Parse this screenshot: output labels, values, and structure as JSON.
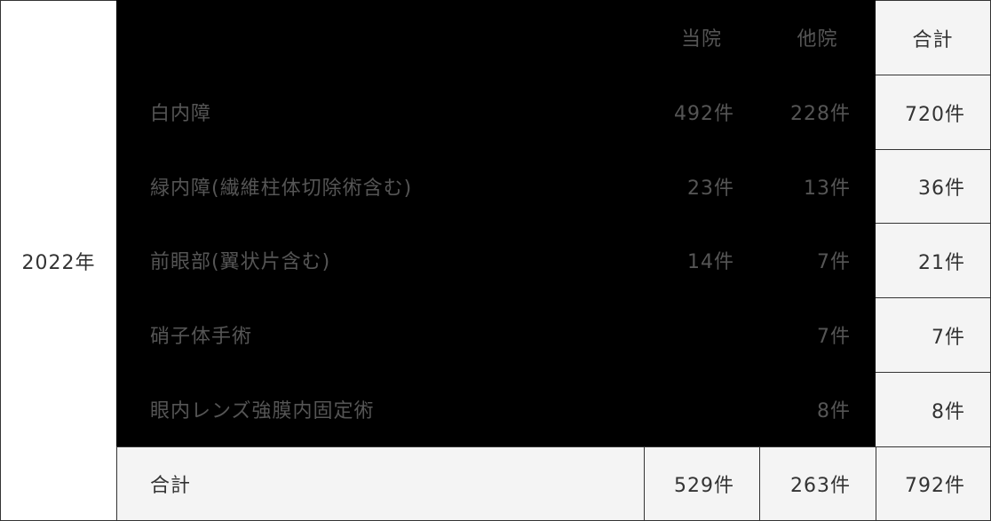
{
  "year": "2022年",
  "header": {
    "own": "当院",
    "other": "他院",
    "total": "合計"
  },
  "rows": [
    {
      "label": "白内障",
      "own": "492件",
      "other": "228件",
      "total": "720件"
    },
    {
      "label": "緑内障(繊維柱体切除術含む)",
      "own": "23件",
      "other": "13件",
      "total": "36件"
    },
    {
      "label": "前眼部(翼状片含む)",
      "own": "14件",
      "other": "7件",
      "total": "21件"
    },
    {
      "label": "硝子体手術",
      "own": "",
      "other": "7件",
      "total": "7件"
    },
    {
      "label": "眼内レンズ強膜内固定術",
      "own": "",
      "other": "8件",
      "total": "8件"
    }
  ],
  "footer": {
    "label": "合計",
    "own": "529件",
    "other": "263件",
    "total": "792件"
  },
  "colors": {
    "dark_block": "#000000",
    "light_cell": "#f4f4f4",
    "border": "#333333",
    "dark_text": "#555555",
    "text": "#333333"
  }
}
